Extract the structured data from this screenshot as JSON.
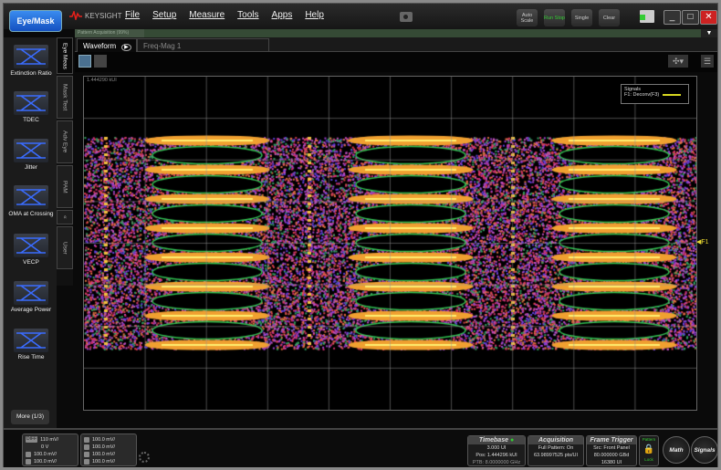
{
  "app": {
    "primary_button": "Eye/Mask",
    "brand": "KEYSIGHT",
    "brand_color": "#e8201a"
  },
  "menu": [
    "File",
    "Setup",
    "Measure",
    "Tools",
    "Apps",
    "Help"
  ],
  "toolbar": {
    "auto_scale": "Auto Scale",
    "run_stop": "Run Stop",
    "single": "Single",
    "clear": "Clear"
  },
  "progress": {
    "label": "Pattern Acquisition   (99%)",
    "percent": 99
  },
  "tabs": {
    "waveform": "Waveform",
    "freqmag": "Freq-Mag 1"
  },
  "measurements": [
    {
      "label": "Extinction Ratio"
    },
    {
      "label": "TDEC"
    },
    {
      "label": "Jitter"
    },
    {
      "label": "OMA at Crossing"
    },
    {
      "label": "VECP"
    },
    {
      "label": "Average Power"
    },
    {
      "label": "Rise Time"
    }
  ],
  "more_button": "More (1/3)",
  "vtabs": [
    "Eye Meas",
    "Mask Test",
    "Adv Eye",
    "PAM",
    "User"
  ],
  "plot": {
    "corner_label": "1.444290 kUI",
    "marker": "F1"
  },
  "legend": {
    "title": "Signals",
    "entry": "F1: Deconv(F3)",
    "color": "#d8d820"
  },
  "channels": {
    "diff": {
      "badge": "DIFF",
      "scale": "110 mV/",
      "offset": "0 V"
    },
    "c": "100.0 mV/",
    "d": "100.0 mV/",
    "a2": "100.0 mV/",
    "b2": "100.0 mV/",
    "c2": "100.0 mV/",
    "d2": "100.0 mV/"
  },
  "timebase": {
    "title": "Timebase",
    "scale": "3.000 UI",
    "pos": "Pos: 1.444296 kUI",
    "ptb": "PTB: 8.0000000 GHz"
  },
  "acquisition": {
    "title": "Acquisition",
    "pattern": "Full Pattern: On",
    "rate": "63.98997525 pts/UI"
  },
  "trigger": {
    "title": "Frame Trigger",
    "src": "Src: Front Panel",
    "rate": "80.000000 GBd",
    "len": "16380 UI"
  },
  "lock": {
    "top": "Pattern",
    "bottom": "Lock"
  },
  "math": "Math",
  "signals": "Signals"
}
